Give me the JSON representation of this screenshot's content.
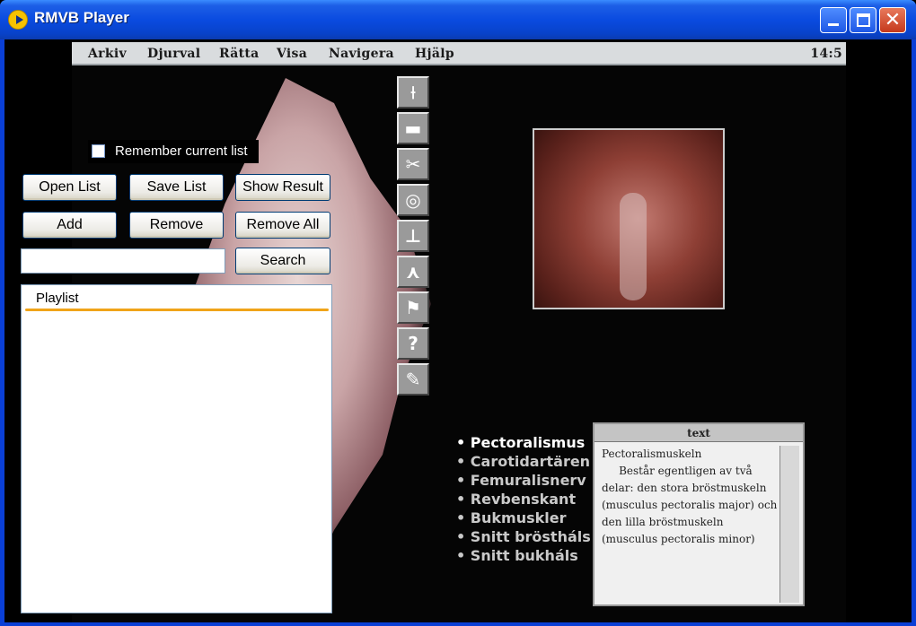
{
  "window": {
    "title": "RMVB Player",
    "controls": {
      "minimize": "minimize",
      "maximize": "maximize",
      "close": "✕"
    }
  },
  "video": {
    "menu": [
      "Arkiv",
      "Djurval",
      "Rätta",
      "Visa",
      "Navigera",
      "Hjälp"
    ],
    "clock": "14:5",
    "bullets": [
      "• Pectoralismus",
      "• Carotidartären",
      "• Femuralisnerv",
      "• Revbenskant",
      "• Bukmuskler",
      "• Snitt bröstháls",
      "• Snitt bukháls"
    ],
    "text_window": {
      "title": "text",
      "body": "Pectoralismuskeln\n     Består egentligen av två delar: den stora bröstmuskeln (musculus pectoralis major) och den lilla bröstmuskeln (musculus pectoralis minor)"
    }
  },
  "panel": {
    "remember_label": "Remember current list",
    "buttons": {
      "open_list": "Open List",
      "save_list": "Save List",
      "show_result": "Show Result",
      "add": "Add",
      "remove": "Remove",
      "remove_all": "Remove All",
      "search": "Search"
    },
    "search_value": "",
    "playlist_header": "Playlist"
  },
  "colors": {
    "titlebar": "#0a4be0",
    "accent": "#f0a419"
  }
}
